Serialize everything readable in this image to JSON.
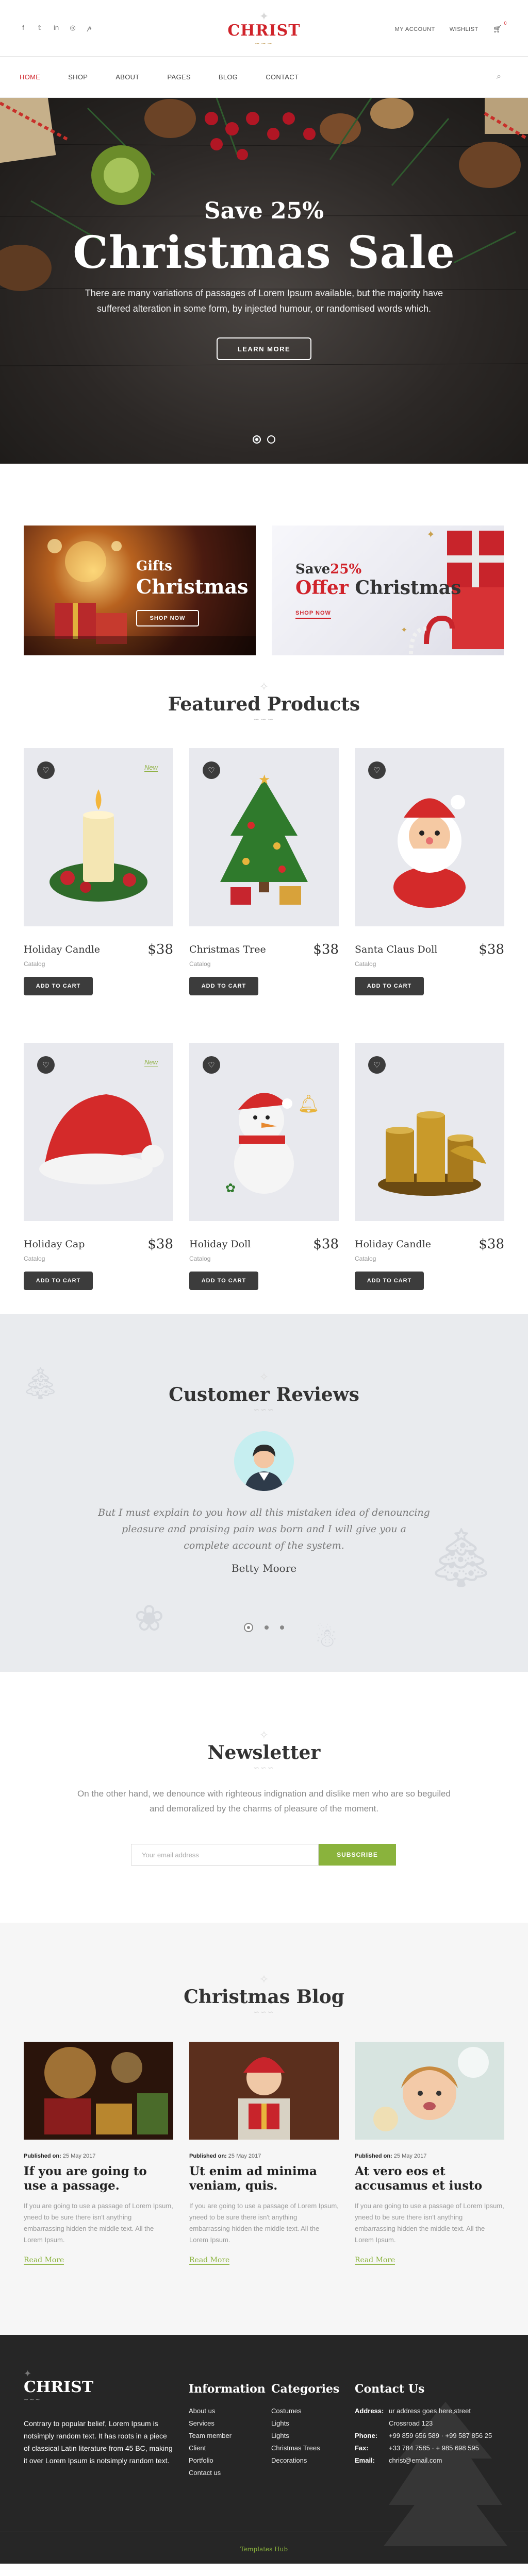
{
  "topbar": {
    "social_icons": [
      "facebook-icon",
      "twitter-icon",
      "linkedin-icon",
      "instagram-icon",
      "pinterest-icon"
    ],
    "social_glyphs": [
      "f",
      "𝕥",
      "in",
      "◎",
      "𝓅"
    ],
    "logo": "CHRIST",
    "my_account": "MY ACCOUNT",
    "wishlist": "WISHLIST",
    "cart_count": "0"
  },
  "nav": {
    "items": [
      "HOME",
      "SHOP",
      "ABOUT",
      "PAGES",
      "BLOG",
      "CONTACT"
    ],
    "active_index": 0
  },
  "hero": {
    "subtitle": "Save 25%",
    "title": "Christmas Sale",
    "text": "There are many variations of passages of Lorem Ipsum available, but the majority have suffered alteration in some form, by injected humour, or randomised words which.",
    "button": "LEARN MORE",
    "slides": 2,
    "active_slide": 0
  },
  "banners": [
    {
      "line1": "Gifts",
      "line2": "Christmas",
      "button": "SHOP NOW"
    },
    {
      "line1_prefix": "Save",
      "line1_accent": "25%",
      "line2_accent": "Offer",
      "line2_rest": " Christmas",
      "button": "SHOP NOW"
    }
  ],
  "products": {
    "heading": "Featured Products",
    "items": [
      {
        "title": "Holiday Candle",
        "price": "$38",
        "category": "Catalog",
        "badge": "New",
        "art": "candle"
      },
      {
        "title": "Christmas Tree",
        "price": "$38",
        "category": "Catalog",
        "badge": "",
        "art": "tree"
      },
      {
        "title": "Santa Claus Doll",
        "price": "$38",
        "category": "Catalog",
        "badge": "",
        "art": "santa"
      },
      {
        "title": "Holiday Cap",
        "price": "$38",
        "category": "Catalog",
        "badge": "New",
        "art": "cap"
      },
      {
        "title": "Holiday Doll",
        "price": "$38",
        "category": "Catalog",
        "badge": "",
        "art": "snowman"
      },
      {
        "title": "Holiday Candle",
        "price": "$38",
        "category": "Catalog",
        "badge": "",
        "art": "gold-candles"
      }
    ],
    "add_to_cart": "ADD TO CART"
  },
  "reviews": {
    "heading": "Customer Reviews",
    "quote": "But I must explain to you how all this mistaken idea of denouncing pleasure and praising pain was born and I will give you a complete account of the system.",
    "author": "Betty Moore",
    "slides": 3,
    "active_slide": 0
  },
  "newsletter": {
    "heading": "Newsletter",
    "text": "On the other hand, we denounce with righteous indignation and dislike men who are so beguiled and demoralized by the charms of pleasure of the moment.",
    "placeholder": "Your email address",
    "button": "SUBSCRIBE"
  },
  "blog": {
    "heading": "Christmas Blog",
    "posts": [
      {
        "meta_label": "Published on:",
        "date": "25 May 2017",
        "title": "If you are going to use a passage.",
        "excerpt": "If you are going to use a passage of Lorem Ipsum, yneed to be sure there isn't anything embarrassing hidden the middle text. All the Lorem Ipsum.",
        "more": "Read More",
        "art": "fireplace"
      },
      {
        "meta_label": "Published on:",
        "date": "25 May 2017",
        "title": "Ut enim ad minima veniam, quis.",
        "excerpt": "If you are going to use a passage of Lorem Ipsum, yneed to be sure there isn't anything embarrassing hidden the middle text. All the Lorem Ipsum.",
        "more": "Read More",
        "art": "child-gift"
      },
      {
        "meta_label": "Published on:",
        "date": "25 May 2017",
        "title": "At vero eos et accusamus et iusto",
        "excerpt": "If you are going to use a passage of Lorem Ipsum, yneed to be sure there isn't anything embarrassing hidden the middle text. All the Lorem Ipsum.",
        "more": "Read More",
        "art": "girl"
      }
    ]
  },
  "footer": {
    "logo": "CHRIST",
    "about": "Contrary to popular belief, Lorem Ipsum is notsimply random text. It has roots in a piece of classical Latin literature from 45 BC, making it over Lorem Ipsum is notsimply random text.",
    "info_title": "Information",
    "info_links": [
      "About us",
      "Services",
      "Team member",
      "Client",
      "Portfolio",
      "Contact us"
    ],
    "cat_title": "Categories",
    "cat_links": [
      "Costumes",
      "Lights",
      "Lights",
      "Christmas Trees",
      "Decorations"
    ],
    "contact_title": "Contact Us",
    "contact": [
      {
        "label": "Address:",
        "value": "ur address goes here,street"
      },
      {
        "label": "",
        "value": "Crossroad 123"
      },
      {
        "label": "Phone:",
        "value": "+99 859 656 589 · +99 587 856 25"
      },
      {
        "label": "Fax:",
        "value": "+33 784 7585 · + 985 698 595"
      },
      {
        "label": "Email:",
        "value": "christ@email.com"
      }
    ],
    "copyright": "Templates Hub"
  },
  "colors": {
    "accent_red": "#d0232a",
    "accent_green": "#8ab33c",
    "dark": "#262626"
  }
}
